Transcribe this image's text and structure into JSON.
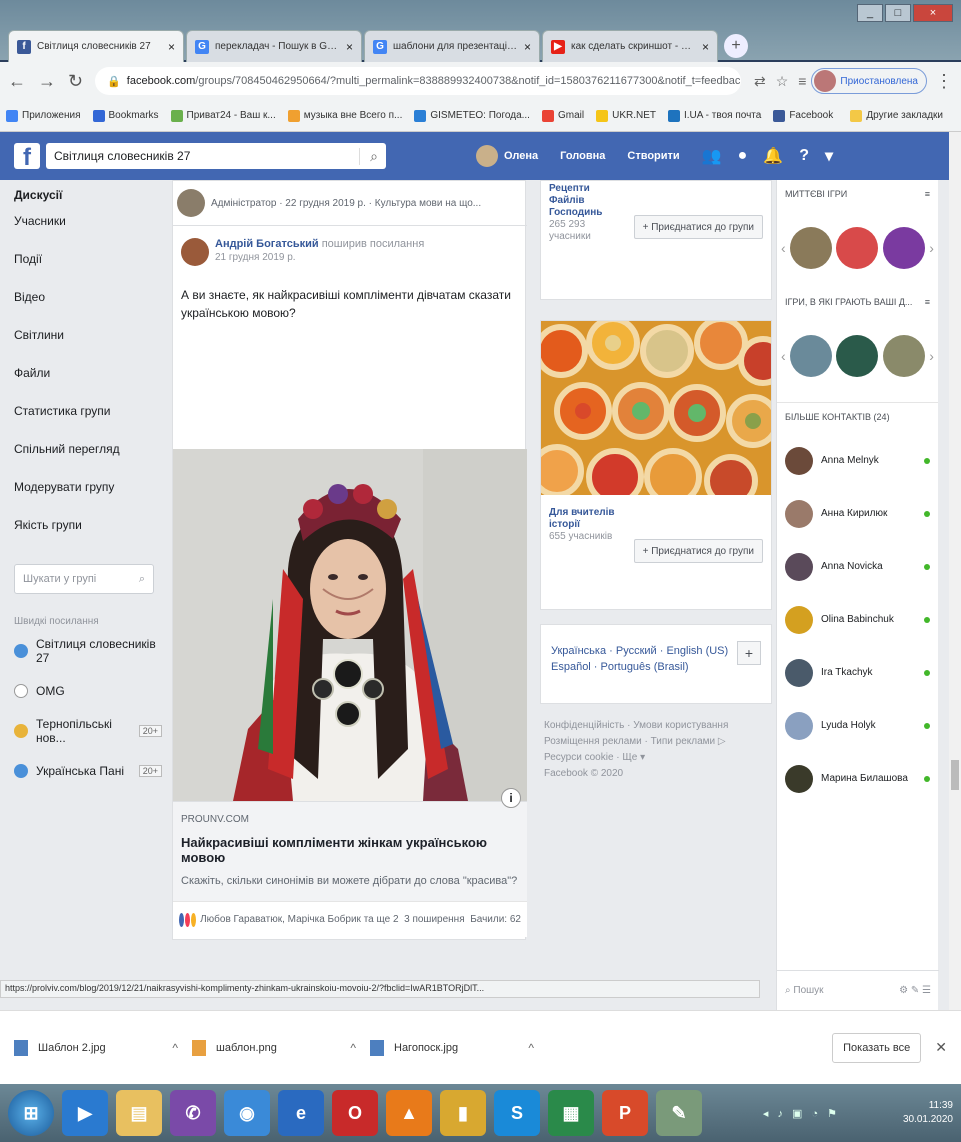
{
  "browser": {
    "tabs": [
      {
        "title": "Світлиця словесників 27",
        "color": "#3b5998",
        "fav": "f"
      },
      {
        "title": "перекладач - Пошук в Google",
        "color": "#4285f4",
        "fav": "G"
      },
      {
        "title": "шаблони для презентацій – Go",
        "color": "#4285f4",
        "fav": "G"
      },
      {
        "title": "как сделать скриншот - YouTube",
        "color": "#e62117",
        "fav": "▶"
      }
    ],
    "url_domain": "facebook.com",
    "url_rest": "/groups/708450462950664/?multi_permalink=838889932400738&notif_id=1580376211677300&notif_t=feedback_rea...",
    "profile_label": "Приостановлена",
    "bookmarks": [
      "Приложения",
      "Bookmarks",
      "Приват24 - Ваш к...",
      "музыка вне Всего п...",
      "GISMETEO: Погода...",
      "Gmail",
      "UKR.NET",
      "I.UA - твоя почта",
      "Facebook",
      "Другие закладки"
    ]
  },
  "facebook": {
    "search_value": "Світлиця словесників 27",
    "user_name": "Олена",
    "nav_home": "Головна",
    "nav_create": "Створити"
  },
  "left_menu": {
    "items": [
      "Дискусії",
      "Учасники",
      "Події",
      "Відео",
      "Світлини",
      "Файли",
      "Статистика групи",
      "Спільний перегляд",
      "Модерувати групу",
      "Якість групи"
    ],
    "search_placeholder": "Шукати у групі",
    "shortcuts_title": "Швидкі посилання",
    "groups": [
      {
        "name": "Світлиця словесників 27",
        "badge": ""
      },
      {
        "name": "OMG",
        "badge": ""
      },
      {
        "name": "Тернопільські нов...",
        "badge": "20+"
      },
      {
        "name": "Українська Пані",
        "badge": "20+"
      }
    ]
  },
  "post": {
    "top_line": "Адміністратор · 22 грудня 2019 р. · Культура мови на що...",
    "author": "Андрій Богатський",
    "action": "поширив посилання",
    "date": "21 грудня 2019 р.",
    "text": "А ви знаєте, як найкрасивіші компліменти дівчатам сказати українською мовою?",
    "link_domain": "PROUNV.COM",
    "link_title": "Найкрасивіші компліменти жінкам українською мовою",
    "link_desc": "Скажіть, скільки синонімів ви можете дібрати до слова \"красива\"? ...",
    "reactions": "Любов Гараватюк, Марічка Бобрик та ще 2",
    "shares": "3 поширення",
    "views": "Бачили: 62"
  },
  "middle": {
    "group1_lines": [
      "Рецепти",
      "Файлів",
      "Господинь"
    ],
    "group1_count": "265 293",
    "group1_count_label": "учасники",
    "join_label": "+ Приєднатися до групи",
    "group2_lines": [
      "Для вчителів",
      "історії"
    ],
    "group2_count": "655 учасників",
    "languages_line1": "Українська · Русский · English (US)",
    "languages_line2": "Español · Português (Brasil)",
    "footer": [
      "Конфіденційність · Умови користування",
      "Розміщення реклами · Типи реклами ▷",
      "Ресурси cookie · Ще ▾",
      "Facebook © 2020"
    ]
  },
  "right": {
    "games_title": "МИТТЄВІ ІГРИ",
    "friends_games_title": "ІГРИ, В ЯКІ ГРАЮТЬ ВАШІ Д...",
    "more_contacts": "БІЛЬШЕ КОНТАКТІВ (24)",
    "contacts": [
      {
        "name": "Anna Melnyk",
        "color": "#6b4a3a"
      },
      {
        "name": "Анна Кирилюк",
        "color": "#9a7a6a"
      },
      {
        "name": "Anna Novicka",
        "color": "#5a4a5a"
      },
      {
        "name": "Olina Babinchuk",
        "color": "#d4a020"
      },
      {
        "name": "Ira Tkachyk",
        "color": "#4a5a6a"
      },
      {
        "name": "Lyuda Holyk",
        "color": "#8aa0c0"
      },
      {
        "name": "Марина Билашова",
        "color": "#3a3a2a"
      }
    ],
    "chat_search": "Пошук"
  },
  "status_url": "https://prolviv.com/blog/2019/12/21/naikrasyvishi-komplimenty-zhinkam-ukrainskoiu-movoiu-2/?fbclid=IwAR1BTORjDlT...",
  "downloads": [
    {
      "name": "Шаблон 2.jpg"
    },
    {
      "name": "шаблон.png"
    },
    {
      "name": "Нагопоск.jpg"
    }
  ],
  "downloads_show_all": "Показать все",
  "clock": {
    "time": "11:39",
    "date": "30.01.2020"
  }
}
